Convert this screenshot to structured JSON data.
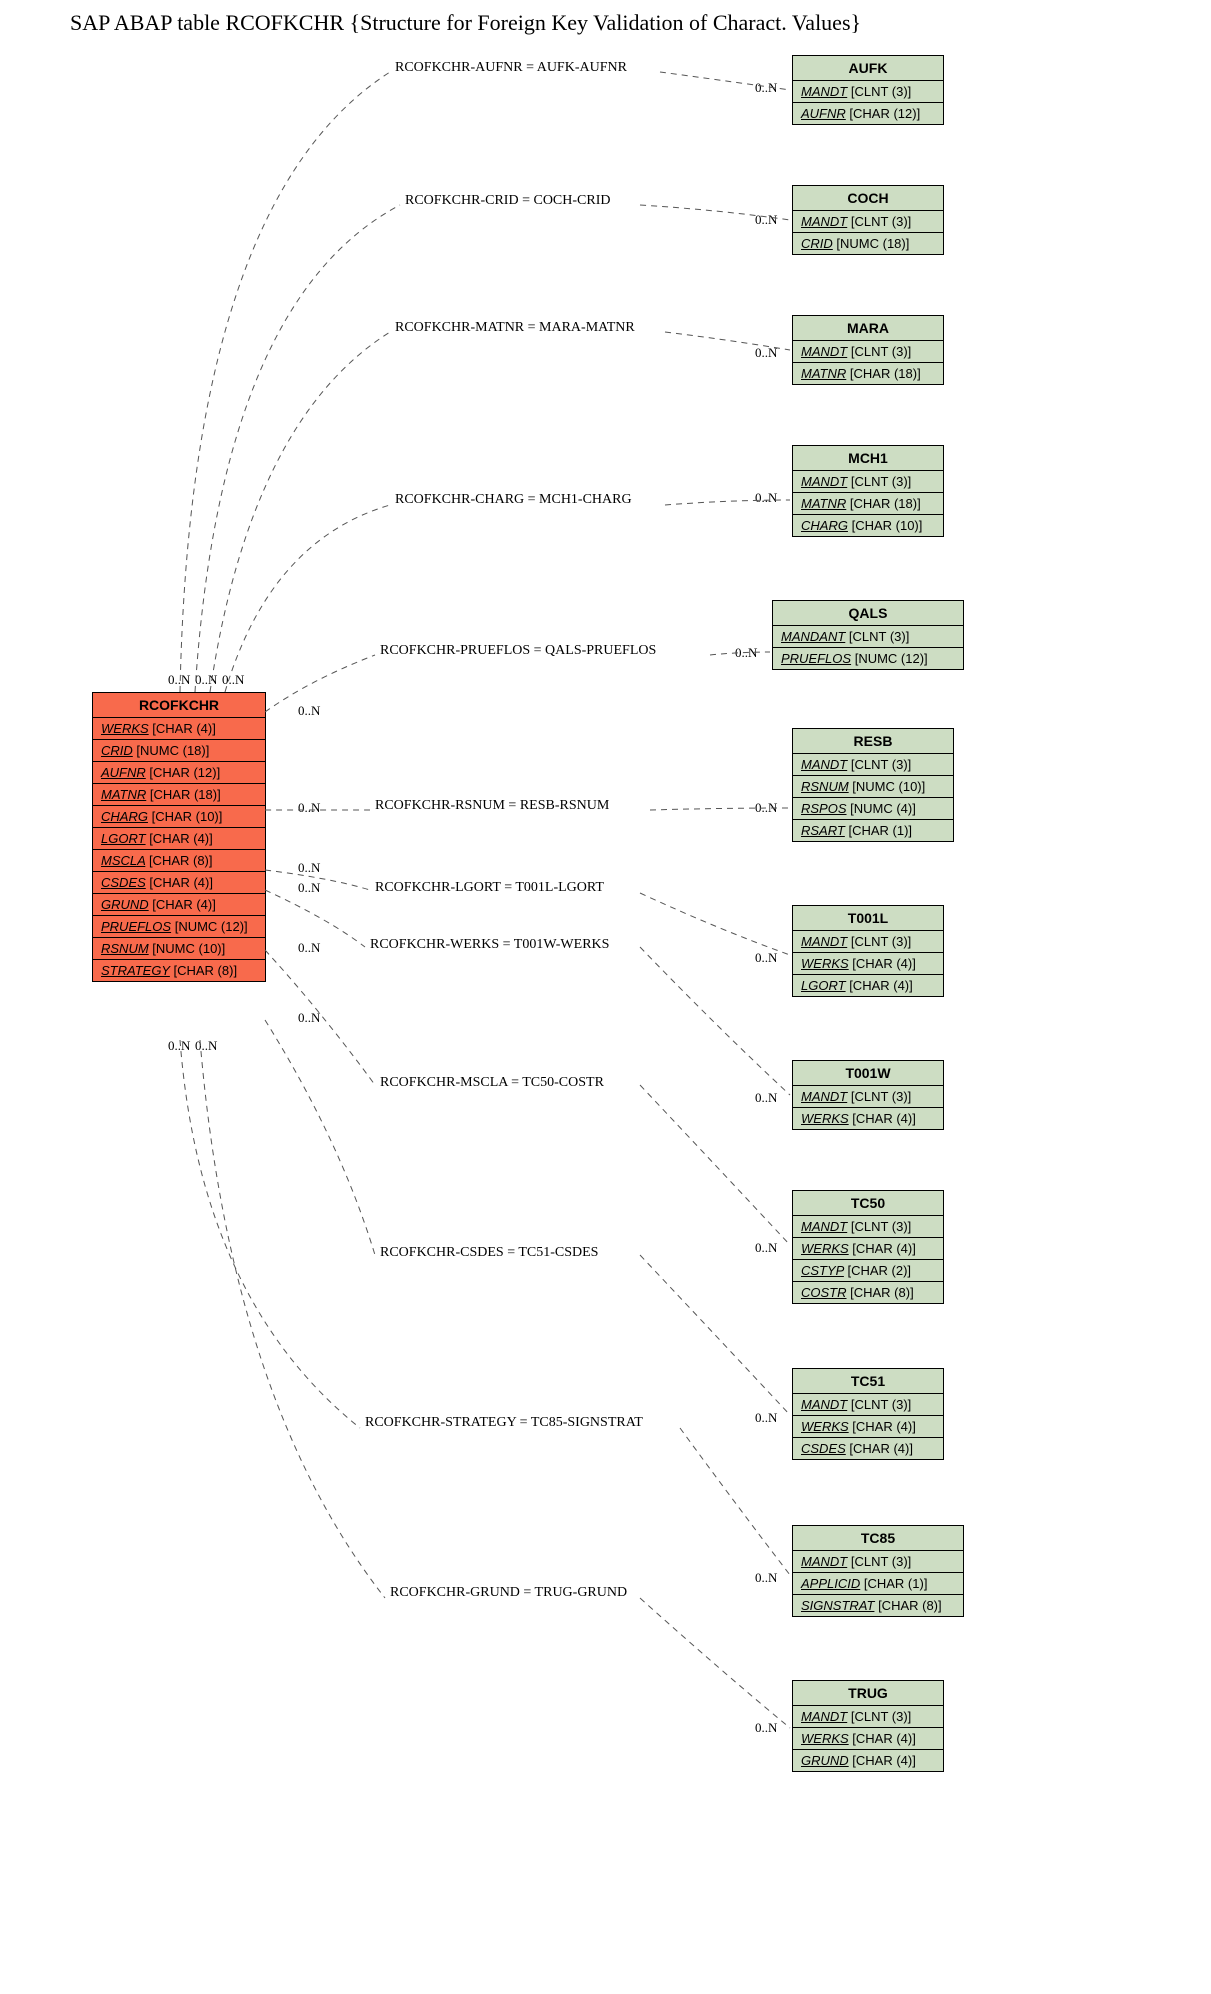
{
  "title": "SAP ABAP table RCOFKCHR {Structure for Foreign Key Validation of Charact. Values}",
  "main_entity": {
    "name": "RCOFKCHR",
    "fields": [
      {
        "name": "WERKS",
        "type": "[CHAR (4)]"
      },
      {
        "name": "CRID",
        "type": "[NUMC (18)]"
      },
      {
        "name": "AUFNR",
        "type": "[CHAR (12)]"
      },
      {
        "name": "MATNR",
        "type": "[CHAR (18)]"
      },
      {
        "name": "CHARG",
        "type": "[CHAR (10)]"
      },
      {
        "name": "LGORT",
        "type": "[CHAR (4)]"
      },
      {
        "name": "MSCLA",
        "type": "[CHAR (8)]"
      },
      {
        "name": "CSDES",
        "type": "[CHAR (4)]"
      },
      {
        "name": "GRUND",
        "type": "[CHAR (4)]"
      },
      {
        "name": "PRUEFLOS",
        "type": "[NUMC (12)]"
      },
      {
        "name": "RSNUM",
        "type": "[NUMC (10)]"
      },
      {
        "name": "STRATEGY",
        "type": "[CHAR (8)]"
      }
    ]
  },
  "entities": [
    {
      "name": "AUFK",
      "fields": [
        {
          "name": "MANDT",
          "type": "[CLNT (3)]"
        },
        {
          "name": "AUFNR",
          "type": "[CHAR (12)]"
        }
      ]
    },
    {
      "name": "COCH",
      "fields": [
        {
          "name": "MANDT",
          "type": "[CLNT (3)]"
        },
        {
          "name": "CRID",
          "type": "[NUMC (18)]"
        }
      ]
    },
    {
      "name": "MARA",
      "fields": [
        {
          "name": "MANDT",
          "type": "[CLNT (3)]"
        },
        {
          "name": "MATNR",
          "type": "[CHAR (18)]"
        }
      ]
    },
    {
      "name": "MCH1",
      "fields": [
        {
          "name": "MANDT",
          "type": "[CLNT (3)]"
        },
        {
          "name": "MATNR",
          "type": "[CHAR (18)]"
        },
        {
          "name": "CHARG",
          "type": "[CHAR (10)]"
        }
      ]
    },
    {
      "name": "QALS",
      "fields": [
        {
          "name": "MANDANT",
          "type": "[CLNT (3)]"
        },
        {
          "name": "PRUEFLOS",
          "type": "[NUMC (12)]"
        }
      ]
    },
    {
      "name": "RESB",
      "fields": [
        {
          "name": "MANDT",
          "type": "[CLNT (3)]"
        },
        {
          "name": "RSNUM",
          "type": "[NUMC (10)]"
        },
        {
          "name": "RSPOS",
          "type": "[NUMC (4)]"
        },
        {
          "name": "RSART",
          "type": "[CHAR (1)]"
        }
      ]
    },
    {
      "name": "T001L",
      "fields": [
        {
          "name": "MANDT",
          "type": "[CLNT (3)]"
        },
        {
          "name": "WERKS",
          "type": "[CHAR (4)]"
        },
        {
          "name": "LGORT",
          "type": "[CHAR (4)]"
        }
      ]
    },
    {
      "name": "T001W",
      "fields": [
        {
          "name": "MANDT",
          "type": "[CLNT (3)]"
        },
        {
          "name": "WERKS",
          "type": "[CHAR (4)]"
        }
      ]
    },
    {
      "name": "TC50",
      "fields": [
        {
          "name": "MANDT",
          "type": "[CLNT (3)]"
        },
        {
          "name": "WERKS",
          "type": "[CHAR (4)]"
        },
        {
          "name": "CSTYP",
          "type": "[CHAR (2)]"
        },
        {
          "name": "COSTR",
          "type": "[CHAR (8)]"
        }
      ]
    },
    {
      "name": "TC51",
      "fields": [
        {
          "name": "MANDT",
          "type": "[CLNT (3)]"
        },
        {
          "name": "WERKS",
          "type": "[CHAR (4)]"
        },
        {
          "name": "CSDES",
          "type": "[CHAR (4)]"
        }
      ]
    },
    {
      "name": "TC85",
      "fields": [
        {
          "name": "MANDT",
          "type": "[CLNT (3)]"
        },
        {
          "name": "APPLICID",
          "type": "[CHAR (1)]"
        },
        {
          "name": "SIGNSTRAT",
          "type": "[CHAR (8)]"
        }
      ]
    },
    {
      "name": "TRUG",
      "fields": [
        {
          "name": "MANDT",
          "type": "[CLNT (3)]"
        },
        {
          "name": "WERKS",
          "type": "[CHAR (4)]"
        },
        {
          "name": "GRUND",
          "type": "[CHAR (4)]"
        }
      ]
    }
  ],
  "relations": [
    {
      "label": "RCOFKCHR-AUFNR = AUFK-AUFNR"
    },
    {
      "label": "RCOFKCHR-CRID = COCH-CRID"
    },
    {
      "label": "RCOFKCHR-MATNR = MARA-MATNR"
    },
    {
      "label": "RCOFKCHR-CHARG = MCH1-CHARG"
    },
    {
      "label": "RCOFKCHR-PRUEFLOS = QALS-PRUEFLOS"
    },
    {
      "label": "RCOFKCHR-RSNUM = RESB-RSNUM"
    },
    {
      "label": "RCOFKCHR-LGORT = T001L-LGORT"
    },
    {
      "label": "RCOFKCHR-WERKS = T001W-WERKS"
    },
    {
      "label": "RCOFKCHR-MSCLA = TC50-COSTR"
    },
    {
      "label": "RCOFKCHR-CSDES = TC51-CSDES"
    },
    {
      "label": "RCOFKCHR-STRATEGY = TC85-SIGNSTRAT"
    },
    {
      "label": "RCOFKCHR-GRUND = TRUG-GRUND"
    }
  ],
  "card_left_cluster": [
    "0..N",
    "0..N",
    "0..N"
  ],
  "card_left_bottom": [
    "0..N",
    "0..N"
  ],
  "card_right_inline": [
    "0..N",
    "0..N",
    "0..N",
    "0..N",
    "0..N",
    "0..N"
  ],
  "card_target": [
    "0..N",
    "0..N",
    "0..N",
    "0..N",
    "0..N",
    "0..N",
    "0..N",
    "0..N",
    "0..N",
    "0..N",
    "0..N",
    "0..N"
  ]
}
